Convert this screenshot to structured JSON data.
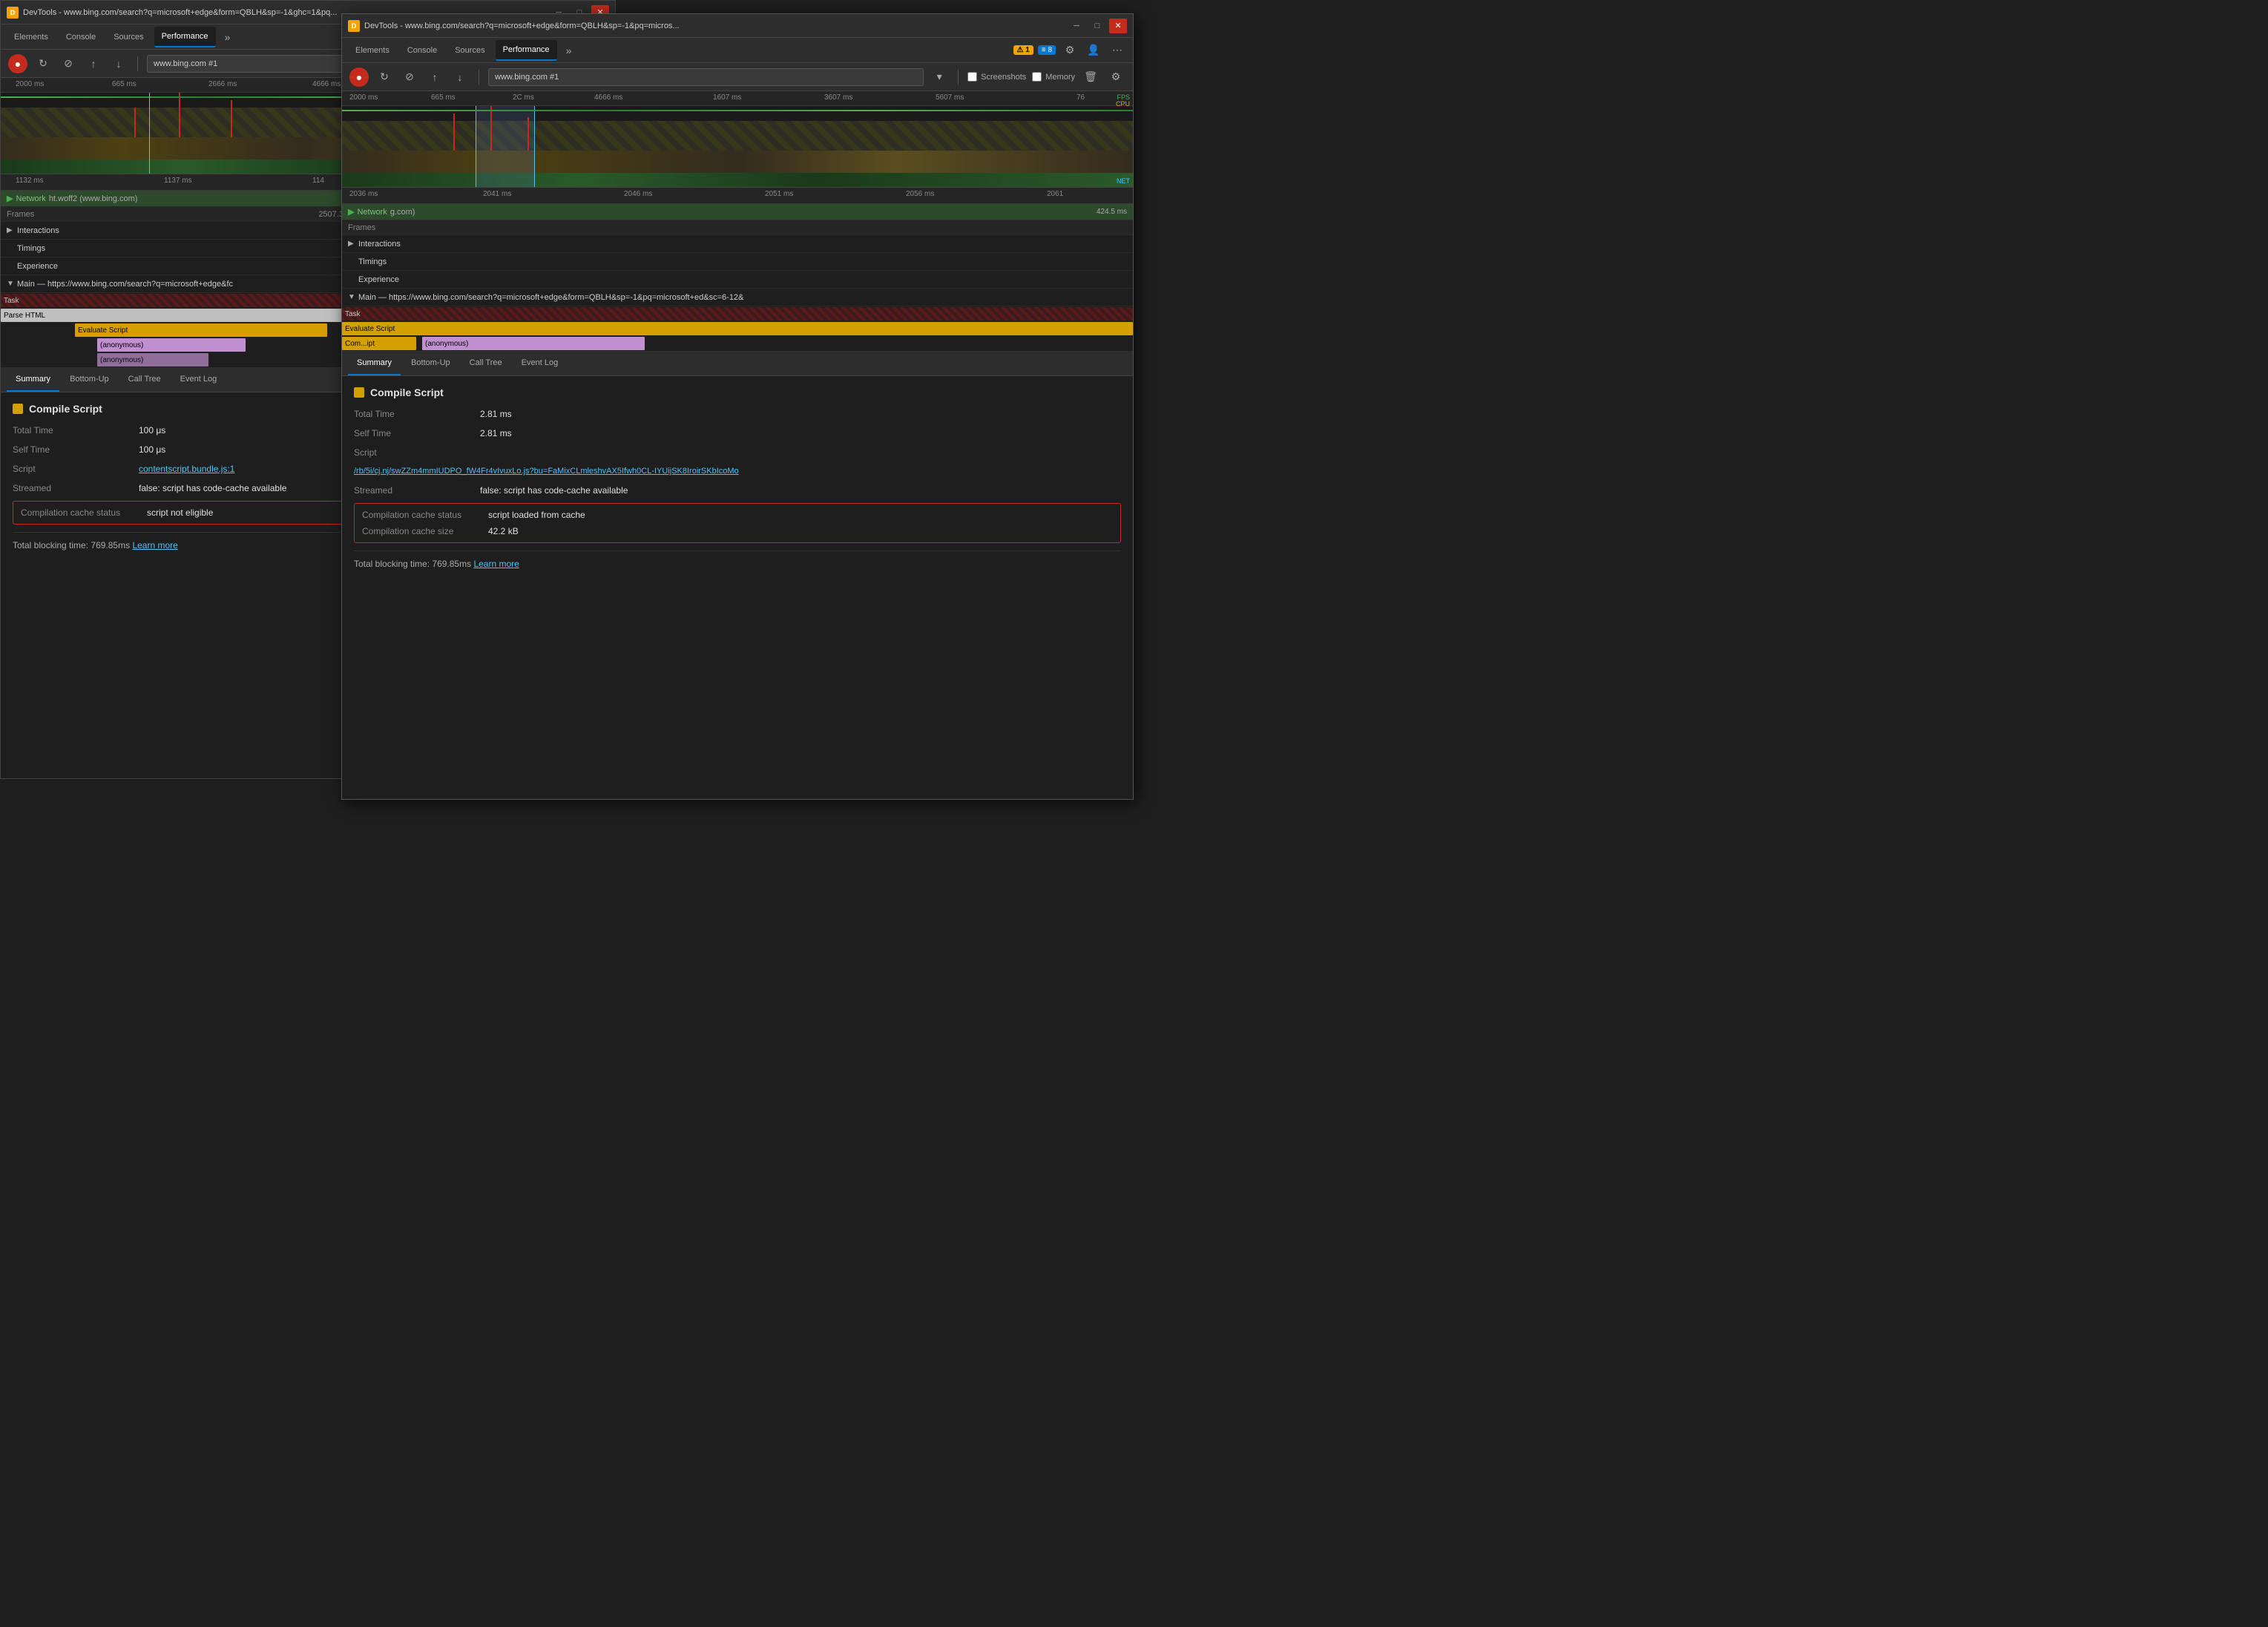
{
  "window1": {
    "title": "DevTools - www.bing.com/search?q=microsoft+edge&form=QBLH&sp=-1&ghc=1&pq...",
    "tabs": [
      {
        "label": "Elements"
      },
      {
        "label": "Console"
      },
      {
        "label": "Sources"
      },
      {
        "label": "Performance",
        "active": true
      }
    ],
    "toolbar": {
      "url": "www.bing.com #1"
    },
    "timeline": {
      "ticks": [
        "2000 ms",
        "665 ms",
        "2666 ms",
        "4666 ms"
      ]
    },
    "sections": {
      "network": {
        "label": "Network",
        "file": "ht.woff2 (www.bing.com)",
        "duration": "2507.3 ms"
      },
      "frames": "Frames",
      "interactions": "Interactions",
      "timings": "Timings",
      "experience": "Experience",
      "main": "Main — https://www.bing.com/search?q=microsoft+edge&fc"
    },
    "flame": {
      "task": "Task",
      "parse_html": "Parse HTML",
      "evaluate_script": "Evaluate Script",
      "anonymous1": "(anonymous)",
      "anonymous2": "(anonymous)"
    },
    "bottom_tabs": [
      "Summary",
      "Bottom-Up",
      "Call Tree",
      "Event Log"
    ],
    "summary": {
      "title": "Compile Script",
      "title_color": "#d4a000",
      "total_time_label": "Total Time",
      "total_time_val": "100 μs",
      "self_time_label": "Self Time",
      "self_time_val": "100 μs",
      "script_label": "Script",
      "script_val": "contentscript.bundle.js:1",
      "streamed_label": "Streamed",
      "streamed_val": "false: script has code-cache available",
      "cache_status_label": "Compilation cache status",
      "cache_status_val": "script not eligible",
      "cache_status_highlighted": true,
      "total_blocking_label": "Total blocking time:",
      "total_blocking_val": "769.85ms",
      "learn_more": "Learn more"
    }
  },
  "window2": {
    "title": "DevTools - www.bing.com/search?q=microsoft+edge&form=QBLH&sp=-1&pq=micros...",
    "tabs": [
      {
        "label": "Elements"
      },
      {
        "label": "Console"
      },
      {
        "label": "Sources"
      },
      {
        "label": "Performance",
        "active": true
      }
    ],
    "tab_bar_icons": {
      "warn": "1",
      "info": "8"
    },
    "toolbar": {
      "url": "www.bing.com #1",
      "screenshots_label": "Screenshots",
      "memory_label": "Memory"
    },
    "timeline": {
      "ticks": [
        "2000 ms",
        "665 ms",
        "2C ms",
        "4666 ms",
        "1607 ms",
        "3607 ms",
        "5607 ms",
        "76"
      ]
    },
    "ruler2": {
      "ticks": [
        "2036 ms",
        "2041 ms",
        "2046 ms",
        "2051 ms",
        "2056 ms",
        "2061"
      ]
    },
    "sections": {
      "network": {
        "label": "Network",
        "file": "g.com)",
        "duration": "424.5 ms"
      },
      "frames": "Frames",
      "interactions": "Interactions",
      "timings": "Timings",
      "experience": "Experience",
      "main": "Main — https://www.bing.com/search?q=microsoft+edge&form=QBLH&sp=-1&pq=microsoft+ed&sc=6-12&"
    },
    "flame": {
      "task": "Task",
      "evaluate_script": "Evaluate Script",
      "compile_ipt": "Com...ipt",
      "anonymous": "(anonymous)"
    },
    "bottom_tabs": [
      "Summary",
      "Bottom-Up",
      "Call Tree",
      "Event Log"
    ],
    "summary": {
      "title": "Compile Script",
      "title_color": "#d4a000",
      "total_time_label": "Total Time",
      "total_time_val": "2.81 ms",
      "self_time_label": "Self Time",
      "self_time_val": "2.81 ms",
      "script_label": "Script",
      "script_val": "/rb/5i/cj.nj/swZZm4mmIUDPO_fW4Fr4vIvuxLo.js?bu=FaMixCLmleshvAX5Ifwh0CL-IYUijSK8IroirSKbIcoMo",
      "streamed_label": "Streamed",
      "streamed_val": "false: script has code-cache available",
      "cache_status_label": "Compilation cache status",
      "cache_status_val": "script loaded from cache",
      "cache_size_label": "Compilation cache size",
      "cache_size_val": "42.2 kB",
      "cache_highlighted": true,
      "total_blocking_label": "Total blocking time:",
      "total_blocking_val": "769.85ms",
      "learn_more": "Learn more"
    }
  }
}
